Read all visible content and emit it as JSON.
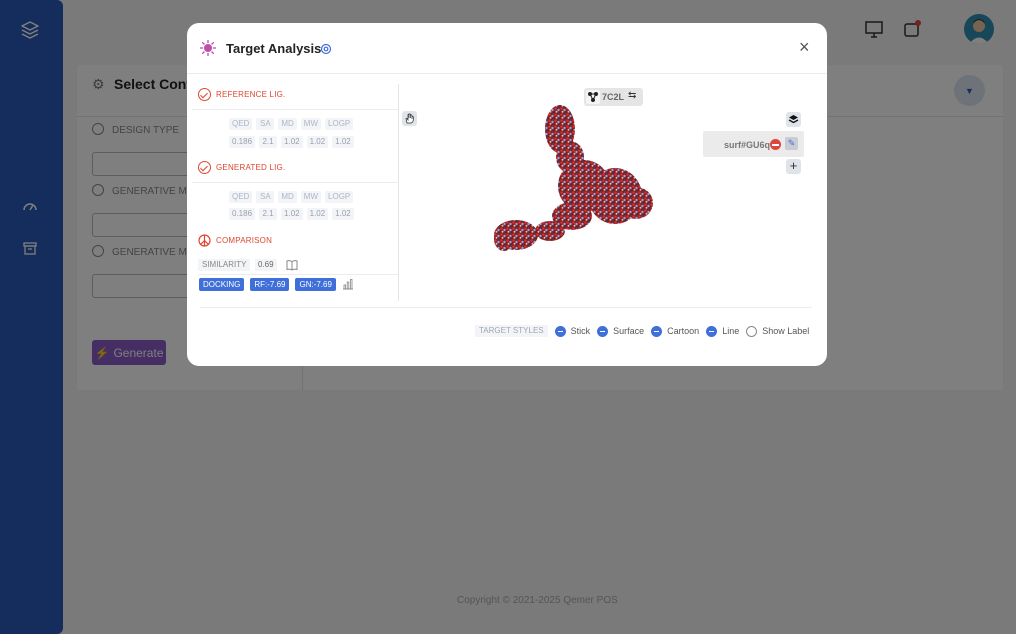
{
  "background": {
    "card_title": "Select Confi",
    "fields": [
      {
        "label": "DESIGN TYPE"
      },
      {
        "label": "GENERATIVE MOD"
      },
      {
        "label": "GENERATIVE MOD"
      }
    ],
    "generate_label": "Generate",
    "copyright": "Copyright © 2021-2025 Qemer POS"
  },
  "modal": {
    "title": "Target Analysis",
    "close_symbol": "×",
    "reference": {
      "label": "REFERENCE LIG.",
      "headers": [
        "QED",
        "SA",
        "MD",
        "MW",
        "LOGP"
      ],
      "values": [
        "0.186",
        "2.1",
        "1.02",
        "1.02",
        "1.02"
      ]
    },
    "generated": {
      "label": "GENERATED LIG.",
      "headers": [
        "QED",
        "SA",
        "MD",
        "MW",
        "LOGP"
      ],
      "values": [
        "0.186",
        "2.1",
        "1.02",
        "1.02",
        "1.02"
      ]
    },
    "comparison": {
      "label": "COMPARISON",
      "similarity_label": "SIMILARITY",
      "similarity_value": "0.69",
      "docking_label": "DOCKING",
      "docking_ref": "RF:-7.69",
      "docking_gen": "GN:-7.69"
    },
    "viewer": {
      "pdb_id": "7C2L",
      "swap_symbol": "⇆",
      "surface_name": "surf#GU6q",
      "add_symbol": "+"
    },
    "target_styles": {
      "label": "TARGET STYLES",
      "options": [
        {
          "label": "Stick",
          "on": true
        },
        {
          "label": "Surface",
          "on": true
        },
        {
          "label": "Cartoon",
          "on": true
        },
        {
          "label": "Line",
          "on": true
        },
        {
          "label": "Show Label",
          "on": false
        }
      ]
    }
  },
  "colors": {
    "sidebar": "#2b5bb8",
    "accent_red": "#e0452f",
    "accent_blue": "#3f6fd8",
    "generate_purple": "#8a5cc7"
  }
}
